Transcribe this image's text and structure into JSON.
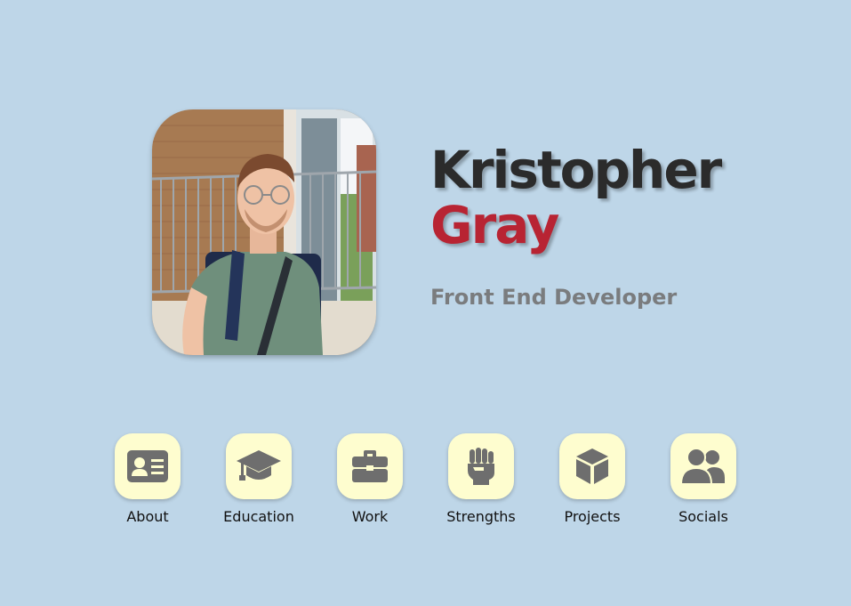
{
  "profile": {
    "first_name": "Kristopher",
    "last_name": "Gray",
    "role": "Front End Developer",
    "photo_alt": "Kristopher Gray"
  },
  "nav": {
    "items": [
      {
        "label": "About",
        "icon": "id-card-icon"
      },
      {
        "label": "Education",
        "icon": "graduation-cap-icon"
      },
      {
        "label": "Work",
        "icon": "briefcase-icon"
      },
      {
        "label": "Strengths",
        "icon": "fist-icon"
      },
      {
        "label": "Projects",
        "icon": "cube-icon"
      },
      {
        "label": "Socials",
        "icon": "users-icon"
      }
    ]
  },
  "colors": {
    "background": "#bed6e8",
    "tile": "#fefdcf",
    "accent": "#b82433",
    "name_dark": "#2b2b2b",
    "role_gray": "#7a7c7e",
    "icon_gray": "#6e6e6e"
  }
}
